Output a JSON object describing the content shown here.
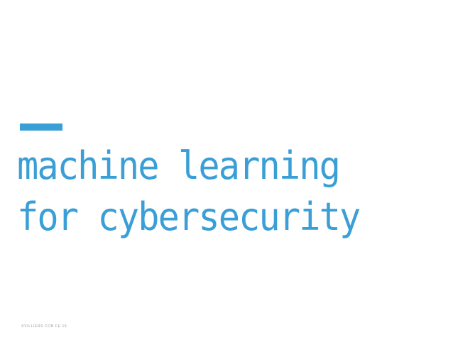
{
  "slide": {
    "title_line_1": "machine learning",
    "title_line_2": "for cybersecurity",
    "footer": "©VILLIERS CON FE 16",
    "accent_color": "#3a9fd6",
    "background_color": "#ffffff"
  }
}
